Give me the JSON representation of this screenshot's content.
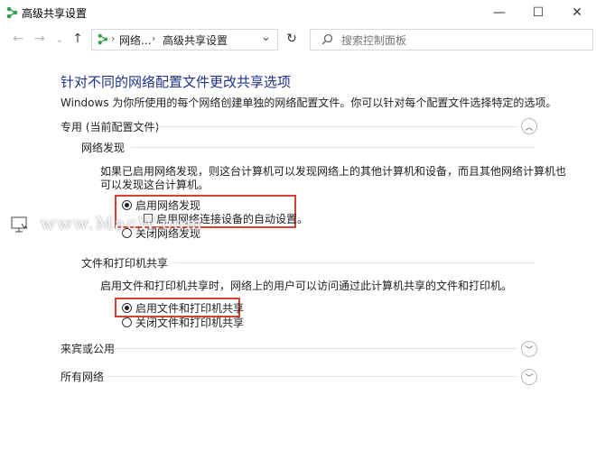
{
  "window": {
    "title": "高级共享设置",
    "minimize": "—",
    "maximize": "☐",
    "close": "✕"
  },
  "nav": {
    "back": "←",
    "forward": "→",
    "history": "⌄",
    "up": "↑",
    "breadcrumb": [
      "网络...",
      "高级共享设置"
    ],
    "separator": "›",
    "refresh": "↻",
    "search_placeholder": "搜索控制面板"
  },
  "content": {
    "heading": "针对不同的网络配置文件更改共享选项",
    "intro": "Windows 为你所使用的每个网络创建单独的网络配置文件。你可以针对每个配置文件选择特定的选项。",
    "profiles": [
      {
        "label": "专用 (当前配置文件)",
        "expanded": true
      },
      {
        "label": "来宾或公用",
        "expanded": false
      },
      {
        "label": "所有网络",
        "expanded": false
      }
    ],
    "discovery": {
      "title": "网络发现",
      "desc_line1": "如果已启用网络发现，则这台计算机可以发现网络上的其他计算机和设备，而且其他网络计算机也",
      "desc_line2": "可以发现这台计算机。",
      "option_on": "启用网络发现",
      "option_auto": "启用网络连接设备的自动设置。",
      "option_off": "关闭网络发现"
    },
    "sharing": {
      "title": "文件和打印机共享",
      "desc": "启用文件和打印机共享时，网络上的用户可以访问通过此计算机共享的文件和打印机。",
      "option_on": "启用文件和打印机共享",
      "option_off": "关闭文件和打印机共享"
    }
  },
  "watermark": "www.MacW.com",
  "colors": {
    "heading": "#1e3287",
    "highlight": "#d64133",
    "accent": "#2fa14b"
  }
}
